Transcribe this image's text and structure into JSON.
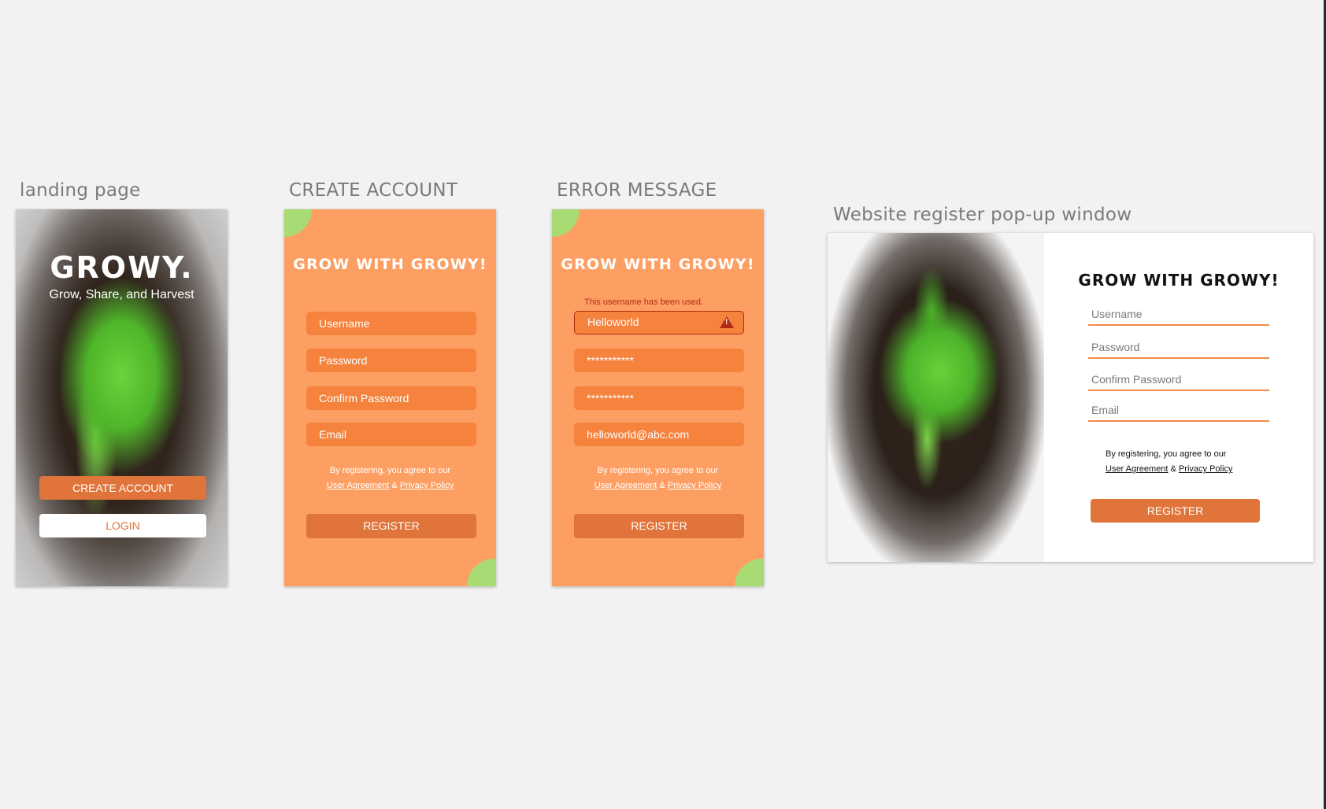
{
  "labels": {
    "landing": "landing page",
    "create": "CREATE ACCOUNT",
    "error": "ERROR MESSAGE",
    "web": "Website register pop-up window"
  },
  "landing": {
    "logo": "GROWY.",
    "tagline": "Grow, Share, and Harvest",
    "create_button": "CREATE ACCOUNT",
    "login_button": "LOGIN"
  },
  "create_account": {
    "title": "GROW WITH GROWY!",
    "username_placeholder": "Username",
    "password_placeholder": "Password",
    "confirm_placeholder": "Confirm Password",
    "email_placeholder": "Email",
    "terms_line1": "By registering, you agree to our",
    "user_agreement": "User Agreement",
    "amp": "&",
    "privacy_policy": "Privacy Policy",
    "register_button": "REGISTER"
  },
  "error_message": {
    "title": "GROW WITH GROWY!",
    "error_text": "This username has been used.",
    "username_value": "Helloworld",
    "password_value": "***********",
    "confirm_value": "***********",
    "email_value": "helloworld@abc.com",
    "terms_line1": "By registering, you agree to our",
    "user_agreement": "User Agreement",
    "amp": "&",
    "privacy_policy": "Privacy Policy",
    "register_button": "REGISTER"
  },
  "web_popup": {
    "title": "GROW WITH GROWY!",
    "username_placeholder": "Username",
    "password_placeholder": "Password",
    "confirm_placeholder": "Confirm Password",
    "email_placeholder": "Email",
    "terms_line1": "By registering, you agree to our",
    "user_agreement": "User Agreement",
    "amp": "&",
    "privacy_policy": "Privacy Policy",
    "register_button": "REGISTER"
  },
  "colors": {
    "canvas": "#f2f2f2",
    "mobile_bg": "#fd9f63",
    "field_bg": "#f5823d",
    "button": "#e0743a",
    "accent_blob": "#a9db74",
    "error": "#b32b14"
  }
}
